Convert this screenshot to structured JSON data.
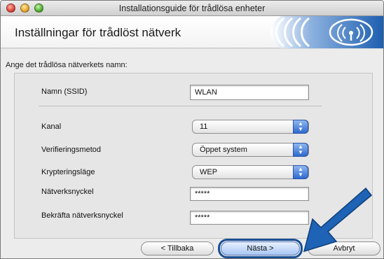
{
  "window": {
    "title": "Installationsguide för trådlösa enheter"
  },
  "header": {
    "title": "Inställningar för trådlöst nätverk",
    "logo_icon": "wireless-signal-icon",
    "logo_color": "#1d5fb0"
  },
  "instruction": "Ange det trådlösa nätverkets namn:",
  "form": {
    "ssid": {
      "label": "Namn (SSID)",
      "value": "WLAN"
    },
    "channel": {
      "label": "Kanal",
      "value": "11"
    },
    "auth": {
      "label": "Verifieringsmetod",
      "value": "Öppet system"
    },
    "encryption": {
      "label": "Krypteringsläge",
      "value": "WEP"
    },
    "key": {
      "label": "Nätverksnyckel",
      "value": "*****"
    },
    "key_confirm": {
      "label": "Bekräfta nätverksnyckel",
      "value": "*****"
    }
  },
  "buttons": {
    "back": "< Tillbaka",
    "next": "Nästa >",
    "cancel": "Avbryt"
  },
  "annotation": {
    "arrow_color": "#1e63b5"
  }
}
